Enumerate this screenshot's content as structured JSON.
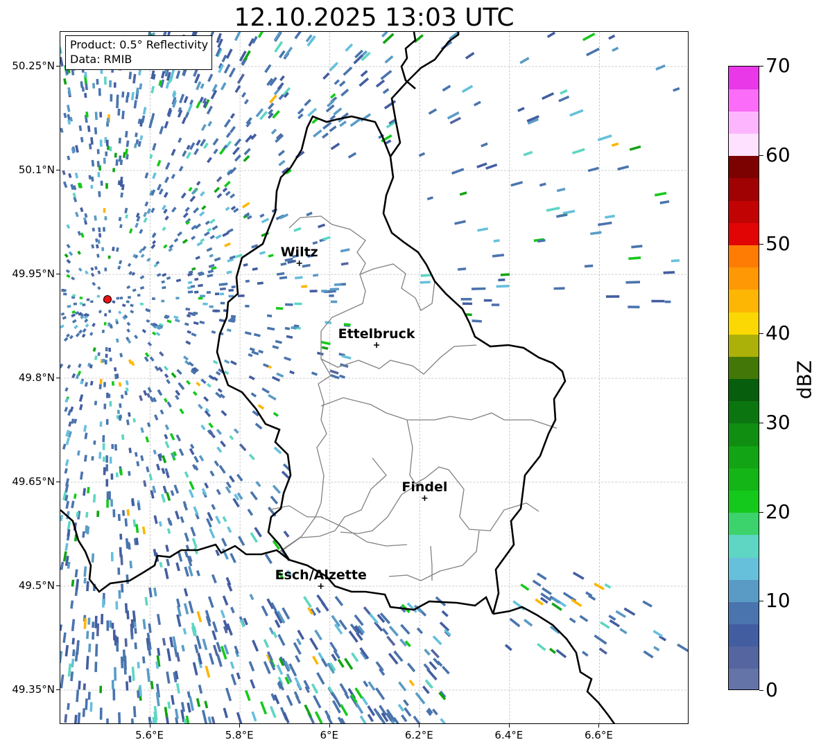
{
  "title": "12.10.2025 13:03 UTC",
  "info_box": {
    "product": "Product: 0.5° Reflectivity",
    "data_source": "Data: RMIB"
  },
  "map": {
    "lon_range": [
      5.4,
      6.8
    ],
    "lat_range": [
      49.3,
      50.3
    ],
    "lat_ticks": [
      {
        "value": 49.35,
        "label": "49.35°N"
      },
      {
        "value": 49.5,
        "label": "49.5°N"
      },
      {
        "value": 49.65,
        "label": "49.65°N"
      },
      {
        "value": 49.8,
        "label": "49.8°N"
      },
      {
        "value": 49.95,
        "label": "49.95°N"
      },
      {
        "value": 50.1,
        "label": "50.1°N"
      },
      {
        "value": 50.25,
        "label": "50.25°N"
      }
    ],
    "lon_ticks": [
      {
        "value": 5.6,
        "label": "5.6°E"
      },
      {
        "value": 5.8,
        "label": "5.8°E"
      },
      {
        "value": 6.0,
        "label": "6°E"
      },
      {
        "value": 6.2,
        "label": "6.2°E"
      },
      {
        "value": 6.4,
        "label": "6.4°E"
      },
      {
        "value": 6.6,
        "label": "6.6°E"
      }
    ],
    "gridlines": true,
    "radar_site": {
      "lon": 5.505,
      "lat": 49.914,
      "marker_color": "#e8141a"
    },
    "cities": [
      {
        "name": "Wiltz",
        "lon": 5.932,
        "lat": 49.966
      },
      {
        "name": "Ettelbruck",
        "lon": 6.104,
        "lat": 49.848
      },
      {
        "name": "Findel",
        "lon": 6.211,
        "lat": 49.627
      },
      {
        "name": "Esch/Alzette",
        "lon": 5.98,
        "lat": 49.5
      }
    ],
    "country_border_color": "#000000",
    "canton_border_color": "#808080"
  },
  "colorbar": {
    "label": "dBZ",
    "min": 0,
    "max": 70,
    "step": 2.5,
    "ticks": [
      {
        "value": 0,
        "label": "0"
      },
      {
        "value": 10,
        "label": "10"
      },
      {
        "value": 20,
        "label": "20"
      },
      {
        "value": 30,
        "label": "30"
      },
      {
        "value": 40,
        "label": "40"
      },
      {
        "value": 50,
        "label": "50"
      },
      {
        "value": 60,
        "label": "60"
      },
      {
        "value": 70,
        "label": "70"
      }
    ],
    "colors": [
      "#6473a8",
      "#5465a0",
      "#435da1",
      "#4a74ad",
      "#5a9bc6",
      "#66c0dc",
      "#5ed6c3",
      "#3cd36c",
      "#15c91c",
      "#14b516",
      "#12a414",
      "#0f8e12",
      "#0b7610",
      "#075e0c",
      "#437707",
      "#abb108",
      "#fbd804",
      "#fdb604",
      "#fe9804",
      "#fe7c03",
      "#e20506",
      "#c10304",
      "#a00203",
      "#7c0202",
      "#fee1fe",
      "#fdb6fd",
      "#fb6cf8",
      "#e838e7"
    ]
  }
}
